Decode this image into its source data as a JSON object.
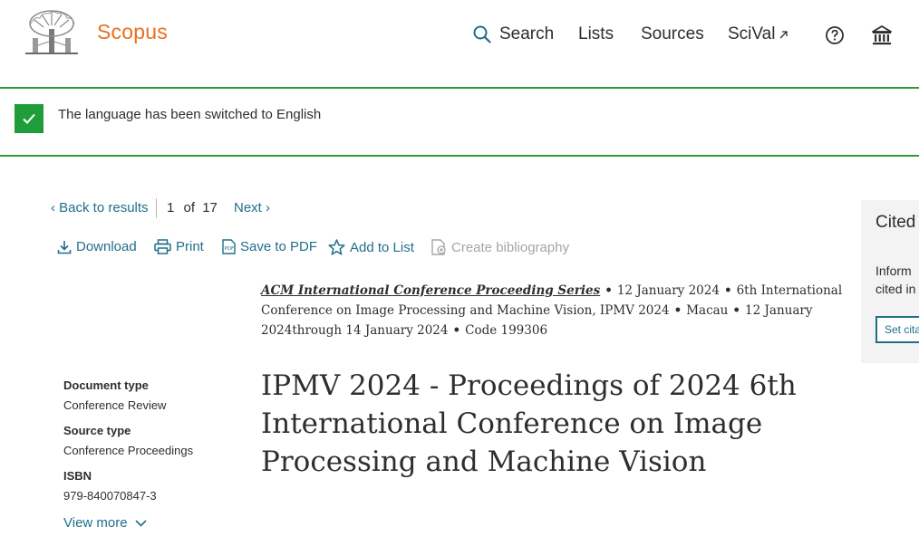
{
  "header": {
    "brand": "Scopus",
    "nav": {
      "search": "Search",
      "lists": "Lists",
      "sources": "Sources",
      "scival": "SciVal"
    },
    "icons": [
      "search-icon",
      "external-link-icon",
      "help-icon",
      "institution-icon"
    ]
  },
  "notification": {
    "message": "The language has been switched to English"
  },
  "result_nav": {
    "back": "Back to results",
    "position": "1",
    "of_label": "of",
    "total": "17",
    "next": "Next"
  },
  "toolbar": {
    "download": "Download",
    "print": "Print",
    "save_pdf": "Save to PDF",
    "add_to_list": "Add to List",
    "create_bibliography": "Create bibliography"
  },
  "source_info": {
    "series": "ACM International Conference Proceeding Series",
    "date": "12 January 2024",
    "conference": "6th International Conference on Image Processing and Machine Vision, IPMV 2024",
    "location": "Macau",
    "dates": "12 January 2024through 14 January 2024",
    "code": "Code 199306"
  },
  "document": {
    "title": "IPMV 2024 - Proceedings of 2024 6th International Conference on Image Processing and Machine Vision"
  },
  "metadata": {
    "document_type_label": "Document type",
    "document_type": "Conference Review",
    "source_type_label": "Source type",
    "source_type": "Conference Proceedings",
    "isbn_label": "ISBN",
    "isbn": "979-840070847-3",
    "view_more": "View more"
  },
  "cited_panel": {
    "title": "Cited",
    "desc_line1": "Inform",
    "desc_line2": "cited in",
    "button": "Set cita"
  },
  "colors": {
    "brand": "#e9711c",
    "link": "#1f6f8b",
    "success": "#1f9d3a",
    "disabled": "#a5a5a5"
  }
}
